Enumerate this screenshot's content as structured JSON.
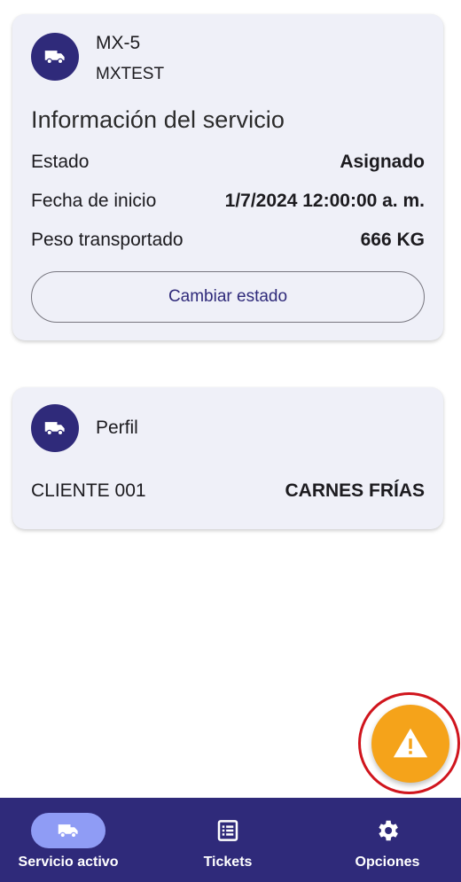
{
  "service_card": {
    "vehicle_icon": "truck-icon",
    "title": "MX-5",
    "subtitle": "MXTEST",
    "section_title": "Información del servicio",
    "rows": [
      {
        "label": "Estado",
        "value": "Asignado"
      },
      {
        "label": "Fecha de inicio",
        "value": "1/7/2024 12:00:00 a. m."
      },
      {
        "label": "Peso transportado",
        "value": "666 KG"
      }
    ],
    "change_status_label": "Cambiar estado"
  },
  "profile_card": {
    "icon": "truck-icon",
    "title": "Perfil",
    "client": "CLIENTE 001",
    "product": "CARNES FRÍAS"
  },
  "fab": {
    "icon": "warning-icon",
    "color": "#f5a31a",
    "highlight_ring_color": "#d0151d"
  },
  "bottom_nav": {
    "items": [
      {
        "label": "Servicio activo",
        "icon": "truck-icon",
        "active": true
      },
      {
        "label": "Tickets",
        "icon": "list-icon",
        "active": false
      },
      {
        "label": "Opciones",
        "icon": "gear-icon",
        "active": false
      }
    ]
  },
  "colors": {
    "primary": "#2f2a7a",
    "card_background": "#eff0f8",
    "active_pill": "#8f9cf5",
    "fab": "#f5a31a"
  }
}
